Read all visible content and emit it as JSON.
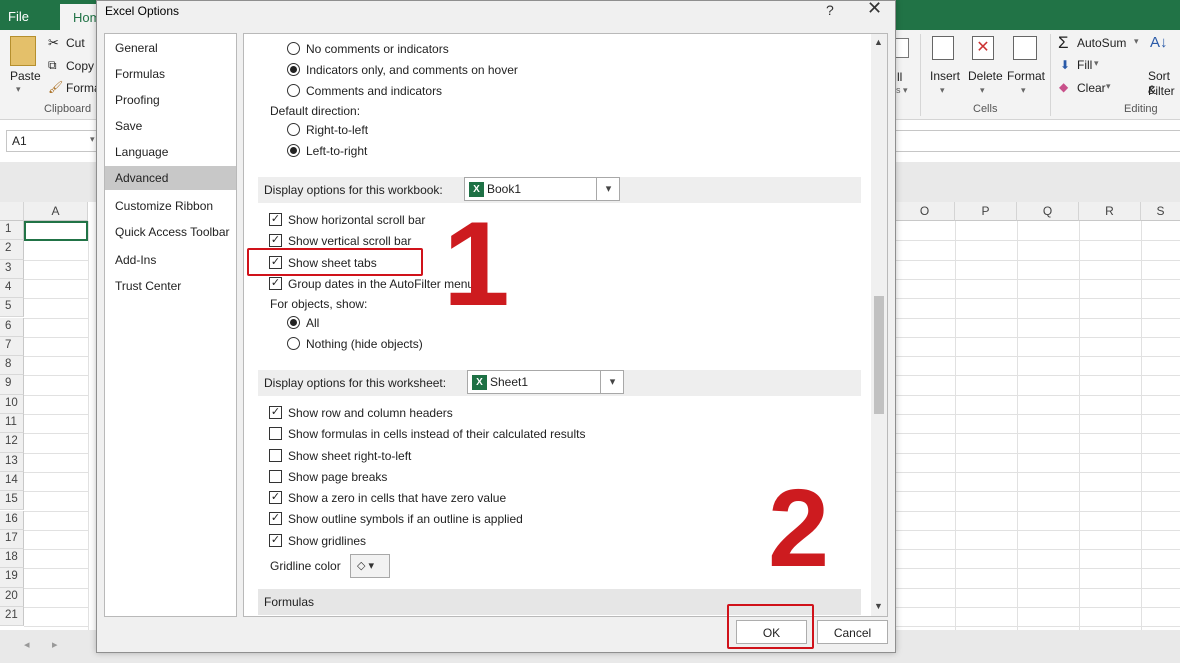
{
  "excel": {
    "tabs": {
      "file": "File",
      "home": "Hom"
    },
    "clipboard": {
      "paste": "Paste",
      "cut": "Cut",
      "copy": "Copy",
      "format_painter": "Forma",
      "group": "Clipboard"
    },
    "cells": {
      "fragment": "ll",
      "insert": "Insert",
      "delete": "Delete",
      "format": "Format",
      "group": "Cells"
    },
    "editing": {
      "autosum": "AutoSum",
      "fill": "Fill",
      "clear": "Clear",
      "sort": "Sort &",
      "filter": "Filter",
      "group": "Editing"
    },
    "name_box": "A1",
    "columns": [
      "A",
      "O",
      "P",
      "Q",
      "R",
      "S"
    ],
    "rows": [
      "1",
      "2",
      "3",
      "4",
      "5",
      "6",
      "7",
      "8",
      "9",
      "10",
      "11",
      "12",
      "13",
      "14",
      "15",
      "16",
      "17",
      "18",
      "19",
      "20",
      "21"
    ]
  },
  "dialog": {
    "title": "Excel Options",
    "help": "?",
    "close": "✕",
    "nav": [
      "General",
      "Formulas",
      "Proofing",
      "Save",
      "Language",
      "Advanced",
      "Customize Ribbon",
      "Quick Access Toolbar",
      "Add-Ins",
      "Trust Center"
    ],
    "active_nav": "Advanced",
    "comments": {
      "no_comments": "No comments or indicators",
      "indicators_only": "Indicators only, and comments on hover",
      "comments_and_indicators": "Comments and indicators"
    },
    "direction": {
      "label": "Default direction:",
      "rtl": "Right-to-left",
      "ltr": "Left-to-right"
    },
    "workbook_section": {
      "label": "Display options for this workbook:",
      "value": "Book1",
      "h_scroll": "Show horizontal scroll bar",
      "v_scroll": "Show vertical scroll bar",
      "sheet_tabs": "Show sheet tabs",
      "group_dates": "Group dates in the AutoFilter menu",
      "objects_label": "For objects, show:",
      "all": "All",
      "nothing": "Nothing (hide objects)"
    },
    "worksheet_section": {
      "label": "Display options for this worksheet:",
      "value": "Sheet1",
      "row_col_headers": "Show row and column headers",
      "formulas": "Show formulas in cells instead of their calculated results",
      "rtl": "Show sheet right-to-left",
      "page_breaks": "Show page breaks",
      "zero": "Show a zero in cells that have zero value",
      "outline": "Show outline symbols if an outline is applied",
      "gridlines": "Show gridlines",
      "gridline_color": "Gridline color"
    },
    "formulas_section": "Formulas",
    "ok": "OK",
    "cancel": "Cancel"
  },
  "annotations": {
    "step1": "1",
    "step2": "2",
    "color": "#d0121a"
  }
}
